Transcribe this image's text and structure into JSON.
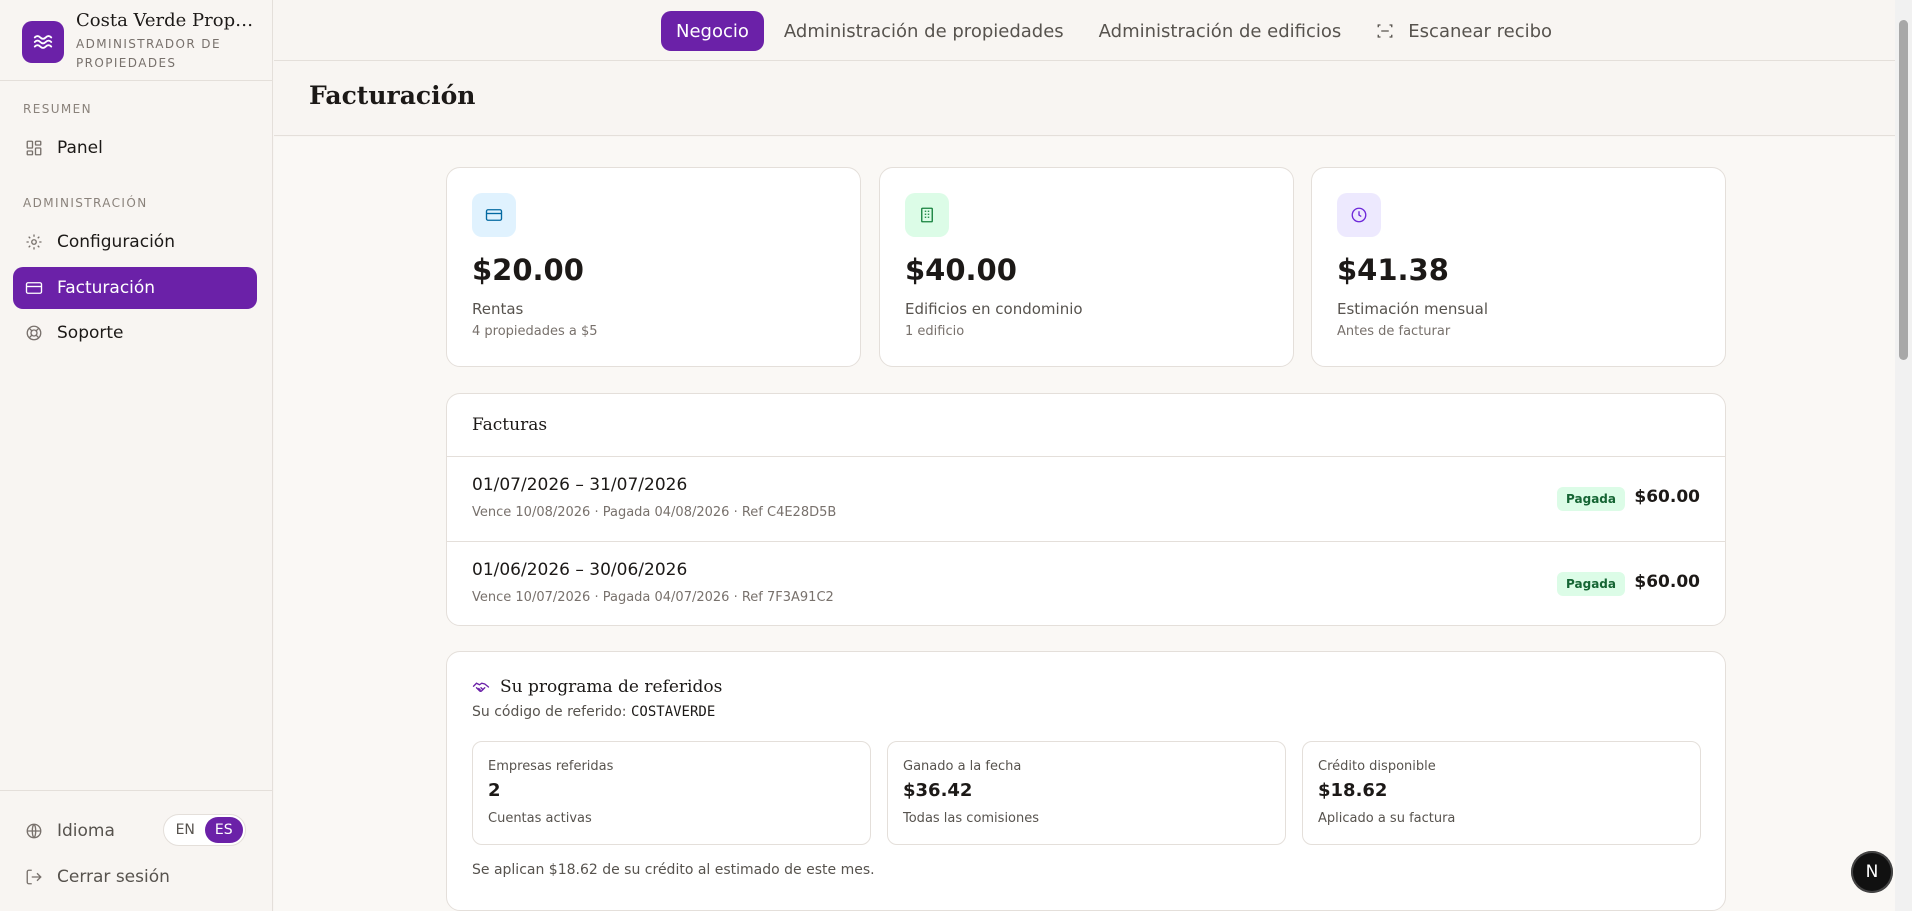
{
  "brand": {
    "name": "Costa Verde Proper...",
    "role": "Administrador de propiedades"
  },
  "sidebar": {
    "sections": [
      {
        "label": "Resumen"
      },
      {
        "label": "Administración"
      }
    ],
    "items": [
      {
        "label": "Panel",
        "icon": "dashboard-grid-icon"
      },
      {
        "label": "Configuración",
        "icon": "gear-icon"
      },
      {
        "label": "Facturación",
        "icon": "credit-card-icon",
        "active": true
      },
      {
        "label": "Soporte",
        "icon": "lifebuoy-icon"
      }
    ],
    "language_label": "Idioma",
    "languages": [
      "EN",
      "ES"
    ],
    "active_language": "ES",
    "logout_label": "Cerrar sesión"
  },
  "topnav": {
    "tabs": [
      {
        "label": "Negocio",
        "active": true
      },
      {
        "label": "Administración de propiedades"
      },
      {
        "label": "Administración de edificios"
      },
      {
        "label": "Escanear recibo",
        "icon": "scan-icon"
      }
    ]
  },
  "page": {
    "title": "Facturación"
  },
  "stats": [
    {
      "value": "$20.00",
      "label": "Rentas",
      "sub": "4 propiedades a $5",
      "icon": "credit-card-icon",
      "icon_bg": "#e0f2fe",
      "icon_color": "#0369a1"
    },
    {
      "value": "$40.00",
      "label": "Edificios en condominio",
      "sub": "1 edificio",
      "icon": "building-icon",
      "icon_bg": "#dcfce7",
      "icon_color": "#15803d"
    },
    {
      "value": "$41.38",
      "label": "Estimación mensual",
      "sub": "Antes de facturar",
      "icon": "clock-icon",
      "icon_bg": "#ede9fe",
      "icon_color": "#6d28d9"
    }
  ],
  "invoices": {
    "title": "Facturas",
    "rows": [
      {
        "period": "01/07/2026 – 31/07/2026",
        "meta": "Vence 10/08/2026 · Pagada 04/08/2026 · Ref C4E28D5B",
        "status": "Pagada",
        "amount": "$60.00"
      },
      {
        "period": "01/06/2026 – 30/06/2026",
        "meta": "Vence 10/07/2026 · Pagada 04/07/2026 · Ref 7F3A91C2",
        "status": "Pagada",
        "amount": "$60.00"
      }
    ]
  },
  "referral": {
    "title": "Su programa de referidos",
    "code_label": "Su código de referido:",
    "code": "COSTAVERDE",
    "boxes": [
      {
        "label": "Empresas referidas",
        "value": "2",
        "sub": "Cuentas activas"
      },
      {
        "label": "Ganado a la fecha",
        "value": "$36.42",
        "sub": "Todas las comisiones"
      },
      {
        "label": "Crédito disponible",
        "value": "$18.62",
        "sub": "Aplicado a su factura"
      }
    ],
    "note": "Se aplican $18.62 de su crédito al estimado de este mes."
  },
  "fab": {
    "label": "N"
  },
  "colors": {
    "accent": "#6b21a8",
    "paid_bg": "#dcfce7",
    "paid_text": "#166534"
  }
}
